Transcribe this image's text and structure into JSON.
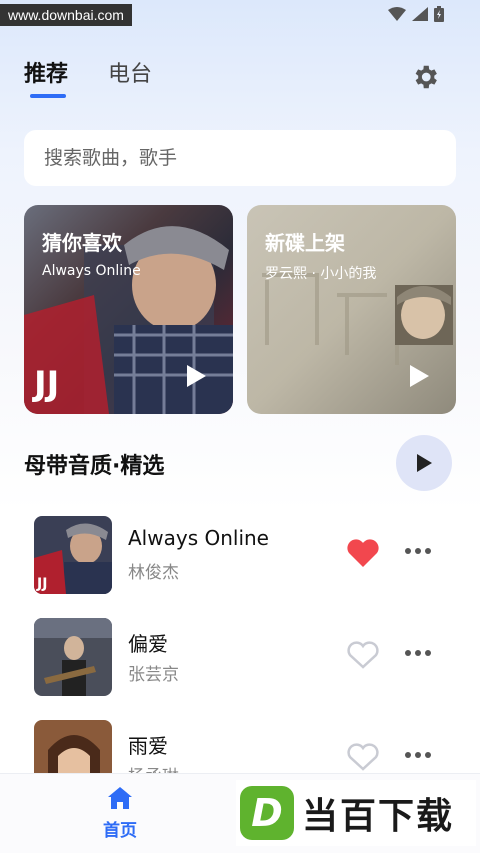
{
  "status_bar": {
    "watermark_url": "www.downbai.com"
  },
  "tabs": [
    {
      "label": "推荐",
      "active": true
    },
    {
      "label": "电台",
      "active": false
    }
  ],
  "search": {
    "placeholder": "搜索歌曲，歌手"
  },
  "cards": [
    {
      "title": "猜你喜欢",
      "subtitle": "Always Online"
    },
    {
      "title": "新碟上架",
      "subtitle": "罗云熙 · 小小的我"
    }
  ],
  "section": {
    "title": "母带音质·精选"
  },
  "songs": [
    {
      "title": "Always Online",
      "artist": "林俊杰",
      "liked": true
    },
    {
      "title": "偏爱",
      "artist": "张芸京",
      "liked": false
    },
    {
      "title": "雨爱",
      "artist": "杨丞琳",
      "liked": false
    }
  ],
  "bottom_nav": {
    "home_label": "首页"
  },
  "site_logo": {
    "badge": "D",
    "text": "当百下载"
  },
  "colors": {
    "accent": "#2e6cf6",
    "heart_active": "#f2474e",
    "heart_inactive": "#c9cbd3"
  }
}
